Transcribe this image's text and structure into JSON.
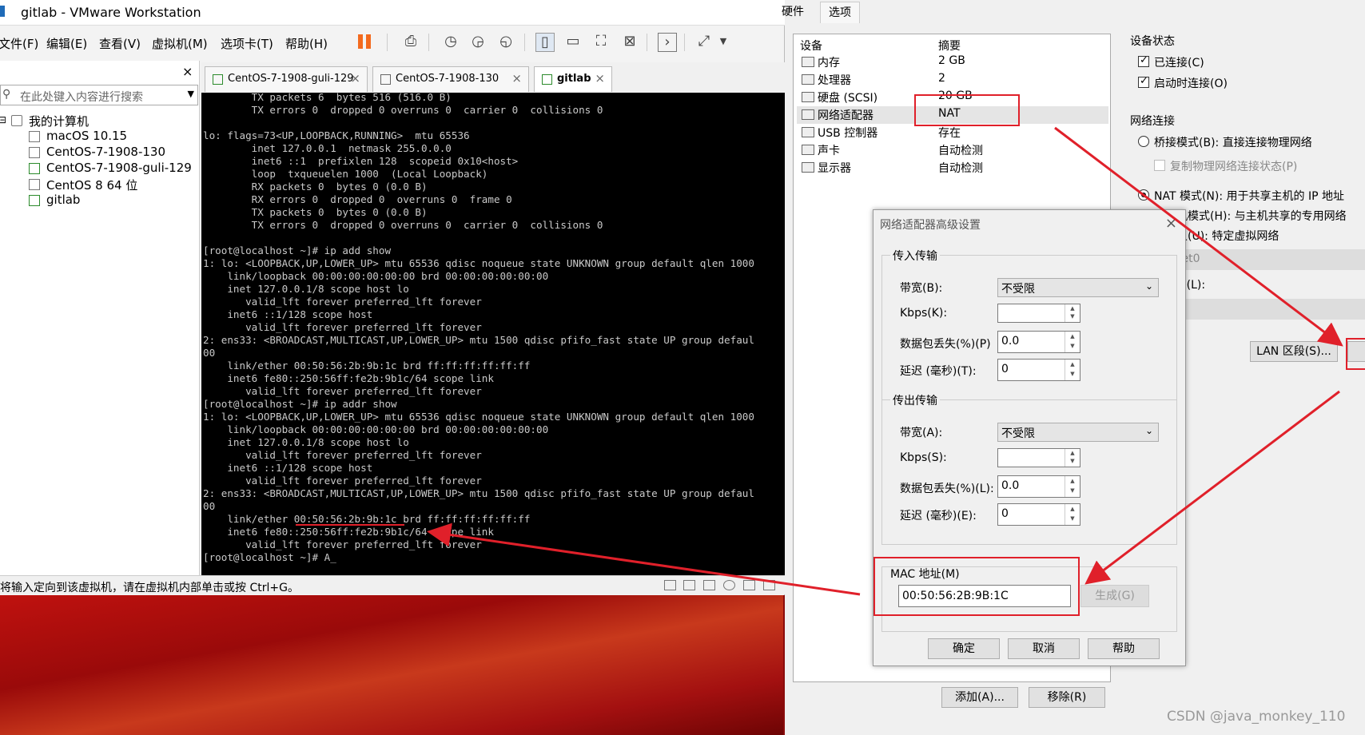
{
  "window": {
    "title": "gitlab - VMware Workstation"
  },
  "menu": [
    "文件(F)",
    "编辑(E)",
    "查看(V)",
    "虚拟机(M)",
    "选项卡(T)",
    "帮助(H)"
  ],
  "library": {
    "close": "×",
    "search_placeholder": "在此处键入内容进行搜索",
    "root": "我的计算机",
    "vms": [
      "macOS 10.15",
      "CentOS-7-1908-130",
      "CentOS-7-1908-guli-129",
      "CentOS 8 64 位",
      "gitlab"
    ]
  },
  "tabs": [
    {
      "label": "CentOS-7-1908-guli-129"
    },
    {
      "label": "CentOS-7-1908-130"
    },
    {
      "label": "gitlab"
    }
  ],
  "terminal": {
    "lines": [
      "        TX packets 6  bytes 516 (516.0 B)",
      "        TX errors 0  dropped 0 overruns 0  carrier 0  collisions 0",
      "",
      "lo: flags=73<UP,LOOPBACK,RUNNING>  mtu 65536",
      "        inet 127.0.0.1  netmask 255.0.0.0",
      "        inet6 ::1  prefixlen 128  scopeid 0x10<host>",
      "        loop  txqueuelen 1000  (Local Loopback)",
      "        RX packets 0  bytes 0 (0.0 B)",
      "        RX errors 0  dropped 0  overruns 0  frame 0",
      "        TX packets 0  bytes 0 (0.0 B)",
      "        TX errors 0  dropped 0 overruns 0  carrier 0  collisions 0",
      "",
      "[root@localhost ~]# ip add show",
      "1: lo: <LOOPBACK,UP,LOWER_UP> mtu 65536 qdisc noqueue state UNKNOWN group default qlen 1000",
      "    link/loopback 00:00:00:00:00:00 brd 00:00:00:00:00:00",
      "    inet 127.0.0.1/8 scope host lo",
      "       valid_lft forever preferred_lft forever",
      "    inet6 ::1/128 scope host",
      "       valid_lft forever preferred_lft forever",
      "2: ens33: <BROADCAST,MULTICAST,UP,LOWER_UP> mtu 1500 qdisc pfifo_fast state UP group defaul",
      "00",
      "    link/ether 00:50:56:2b:9b:1c brd ff:ff:ff:ff:ff:ff",
      "    inet6 fe80::250:56ff:fe2b:9b1c/64 scope link",
      "       valid_lft forever preferred_lft forever",
      "[root@localhost ~]# ip addr show",
      "1: lo: <LOOPBACK,UP,LOWER_UP> mtu 65536 qdisc noqueue state UNKNOWN group default qlen 1000",
      "    link/loopback 00:00:00:00:00:00 brd 00:00:00:00:00:00",
      "    inet 127.0.0.1/8 scope host lo",
      "       valid_lft forever preferred_lft forever",
      "    inet6 ::1/128 scope host",
      "       valid_lft forever preferred_lft forever",
      "2: ens33: <BROADCAST,MULTICAST,UP,LOWER_UP> mtu 1500 qdisc pfifo_fast state UP group defaul",
      "00",
      "    link/ether 00:50:56:2b:9b:1c brd ff:ff:ff:ff:ff:ff",
      "    inet6 fe80::250:56ff:fe2b:9b1c/64 scope link",
      "       valid_lft forever preferred_lft forever",
      "[root@localhost ~]# A_"
    ]
  },
  "status": {
    "text": "将输入定向到该虚拟机，请在虚拟机内部单击或按 Ctrl+G。"
  },
  "settings": {
    "tabs": [
      "硬件",
      "选项"
    ],
    "device_header": "设备",
    "summary_header": "摘要",
    "devices": [
      {
        "name": "内存",
        "summary": "2 GB"
      },
      {
        "name": "处理器",
        "summary": "2"
      },
      {
        "name": "硬盘 (SCSI)",
        "summary": "20 GB"
      },
      {
        "name": "网络适配器",
        "summary": "NAT"
      },
      {
        "name": "USB 控制器",
        "summary": "存在"
      },
      {
        "name": "声卡",
        "summary": "自动检测"
      },
      {
        "name": "显示器",
        "summary": "自动检测"
      }
    ],
    "device_status": "设备状态",
    "connected": "已连接(C)",
    "connect_on_start": "启动时连接(O)",
    "net_conn": "网络连接",
    "bridged": "桥接模式(B): 直接连接物理网络",
    "replicate": "复制物理网络连接状态(P)",
    "nat": "NAT 模式(N): 用于共享主机的 IP 地址",
    "hostonly": "仅主机模式(H): 与主机共享的专用网络",
    "custom": "自定义(U): 特定虚拟网络",
    "vmnet": "VMnet0",
    "lan": "LAN 区段(L):",
    "lan_btn": "LAN 区段(S)...",
    "add_btn": "添加(A)...",
    "remove_btn": "移除(R)"
  },
  "advanced": {
    "title": "网络适配器高级设置",
    "close": "×",
    "incoming": "传入传输",
    "outgoing": "传出传输",
    "in_bw_label": "带宽(B):",
    "in_bw": "不受限",
    "in_kbps_label": "Kbps(K):",
    "in_kbps": "",
    "in_loss_label": "数据包丢失(%)(P)",
    "in_loss": "0.0",
    "in_lat_label": "延迟 (毫秒)(T):",
    "in_lat": "0",
    "out_bw_label": "带宽(A):",
    "out_bw": "不受限",
    "out_kbps_label": "Kbps(S):",
    "out_kbps": "",
    "out_loss_label": "数据包丢失(%)(L):",
    "out_loss": "0.0",
    "out_lat_label": "延迟 (毫秒)(E):",
    "out_lat": "0",
    "mac_label": "MAC 地址(M)",
    "mac": "00:50:56:2B:9B:1C",
    "generate": "生成(G)",
    "ok": "确定",
    "cancel": "取消",
    "help": "帮助"
  },
  "watermark": "CSDN @java_monkey_110",
  "colors": {
    "annotation": "#e0202a",
    "pause": "#f36a1e"
  }
}
